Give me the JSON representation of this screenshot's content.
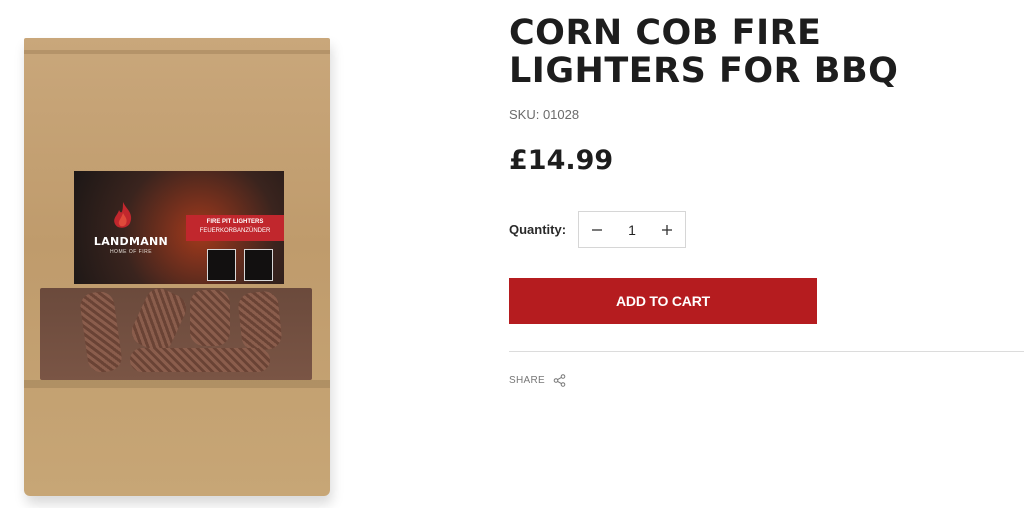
{
  "product": {
    "title": "CORN COB FIRE LIGHTERS FOR BBQ",
    "sku": "SKU: 01028",
    "price": "£14.99"
  },
  "quantity": {
    "label": "Quantity:",
    "value": "1",
    "minus_icon": "minus-icon",
    "plus_icon": "plus-icon"
  },
  "cart": {
    "add_label": "ADD TO CART"
  },
  "share": {
    "label": "SHARE",
    "icon": "share-icon"
  },
  "image": {
    "brand": "LANDMANN",
    "brand_sub": "HOME OF FIRE",
    "band_line1": "FIRE PIT LIGHTERS",
    "band_line2": "FEUERKORBANZÜNDER"
  },
  "colors": {
    "accent": "#b51c1f",
    "text": "#1d1d1d",
    "muted": "#6b6b6b"
  }
}
